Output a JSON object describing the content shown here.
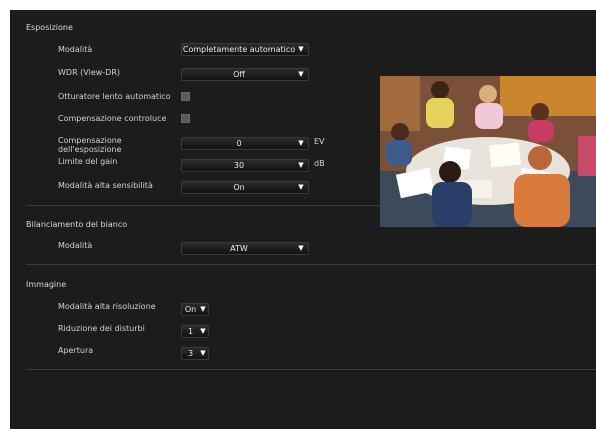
{
  "exposure": {
    "title": "Esposizione",
    "mode_label": "Modalità",
    "mode_value": "Completamente automatico",
    "wdr_label": "WDR (View-DR)",
    "wdr_value": "Off",
    "slow_shutter_label": "Otturatore lento automatico",
    "backlight_label": "Compensazione controluce",
    "exp_comp_label_1": "Compensazione",
    "exp_comp_label_2": "dell'esposizione",
    "exp_comp_value": "0",
    "exp_comp_unit": "EV",
    "gain_label": "Limite del gain",
    "gain_value": "30",
    "gain_unit": "dB",
    "high_sens_label": "Modalità alta sensibilità",
    "high_sens_value": "On"
  },
  "white_balance": {
    "title": "Bilanciamento del bianco",
    "mode_label": "Modalità",
    "mode_value": "ATW"
  },
  "image": {
    "title": "Immagine",
    "high_res_label": "Modalità alta risoluzione",
    "high_res_value": "On",
    "noise_label": "Riduzione dei disturbi",
    "noise_value": "1",
    "aperture_label": "Apertura",
    "aperture_value": "3"
  },
  "icons": {
    "dropdown": "▼"
  },
  "colors": {
    "panel_bg": "#1c1c1c",
    "text": "#d2d2d2",
    "divider": "#3a3a3a"
  }
}
